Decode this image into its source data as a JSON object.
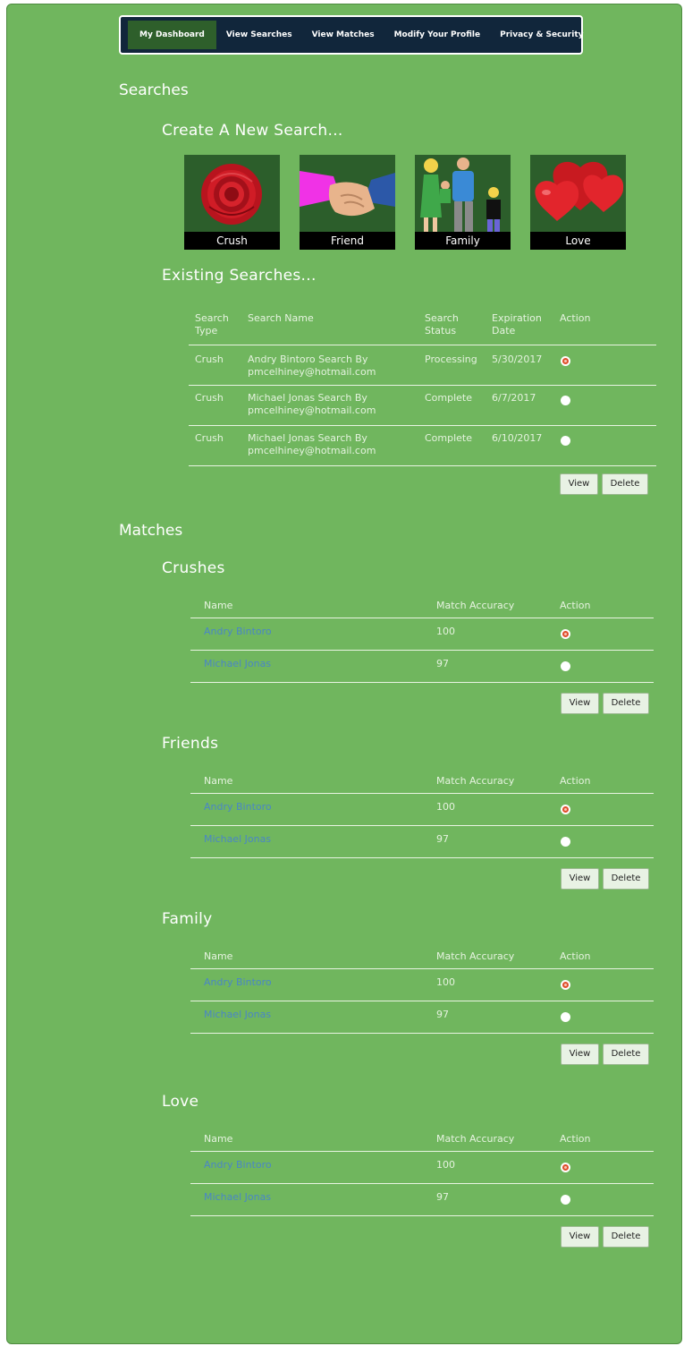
{
  "nav": {
    "items": [
      "My Dashboard",
      "View Searches",
      "View Matches",
      "Modify Your Profile",
      "Privacy & Security"
    ]
  },
  "searches": {
    "heading": "Searches",
    "create_heading": "Create A New Search...",
    "tiles": [
      "Crush",
      "Friend",
      "Family",
      "Love"
    ],
    "existing_heading": "Existing Searches...",
    "columns": {
      "type": "Search Type",
      "name": "Search Name",
      "status": "Search Status",
      "expiration": "Expiration Date",
      "action": "Action"
    },
    "rows": [
      {
        "type": "Crush",
        "name": "Andry Bintoro Search By pmcelhiney@hotmail.com",
        "status": "Processing",
        "expiration": "5/30/2017",
        "selected": true
      },
      {
        "type": "Crush",
        "name": "Michael Jonas Search By pmcelhiney@hotmail.com",
        "status": "Complete",
        "expiration": "6/7/2017",
        "selected": false
      },
      {
        "type": "Crush",
        "name": "Michael Jonas Search By pmcelhiney@hotmail.com",
        "status": "Complete",
        "expiration": "6/10/2017",
        "selected": false
      }
    ],
    "view_label": "View",
    "delete_label": "Delete"
  },
  "matches": {
    "heading": "Matches",
    "columns": {
      "name": "Name",
      "accuracy": "Match Accuracy",
      "action": "Action"
    },
    "groups": [
      {
        "title": "Crushes",
        "rows": [
          {
            "name": "Andry Bintoro",
            "accuracy": "100",
            "selected": true
          },
          {
            "name": "Michael Jonas",
            "accuracy": "97",
            "selected": false
          }
        ]
      },
      {
        "title": "Friends",
        "rows": [
          {
            "name": "Andry Bintoro",
            "accuracy": "100",
            "selected": true
          },
          {
            "name": "Michael Jonas",
            "accuracy": "97",
            "selected": false
          }
        ]
      },
      {
        "title": "Family",
        "rows": [
          {
            "name": "Andry Bintoro",
            "accuracy": "100",
            "selected": true
          },
          {
            "name": "Michael Jonas",
            "accuracy": "97",
            "selected": false
          }
        ]
      },
      {
        "title": "Love",
        "rows": [
          {
            "name": "Andry Bintoro",
            "accuracy": "100",
            "selected": true
          },
          {
            "name": "Michael Jonas",
            "accuracy": "97",
            "selected": false
          }
        ]
      }
    ],
    "view_label": "View",
    "delete_label": "Delete"
  },
  "colors": {
    "page_bg": "#70b65e",
    "nav_bg": "#11263b",
    "nav_active": "#2e5f2b",
    "link": "#4a86c6",
    "radio_selected": "#e04e2b"
  }
}
